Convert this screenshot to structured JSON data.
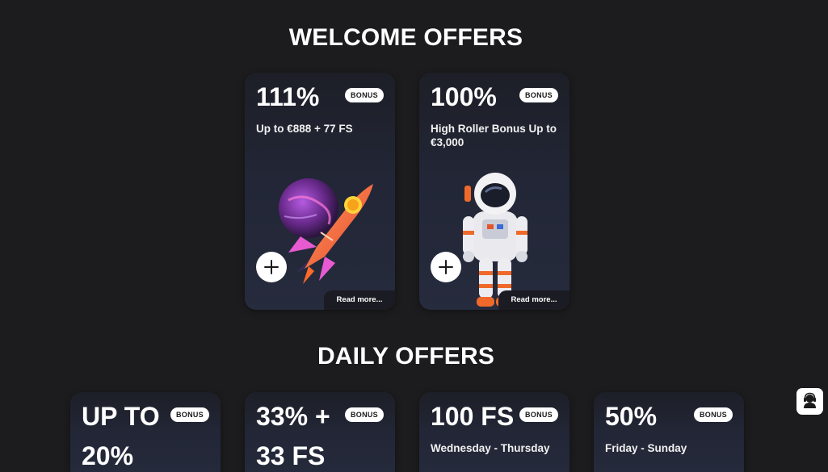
{
  "welcome": {
    "title": "WELCOME OFFERS",
    "cards": [
      {
        "percent": "111%",
        "badge": "BONUS",
        "desc": "Up to €888 + 77 FS",
        "read_more": "Read more...",
        "icon": "rocket-illustration"
      },
      {
        "percent": "100%",
        "badge": "BONUS",
        "desc": "High Roller Bonus Up to €3,000",
        "read_more": "Read more...",
        "icon": "astronaut-illustration"
      }
    ]
  },
  "daily": {
    "title": "DAILY OFFERS",
    "cards": [
      {
        "percent": "UP TO 20%",
        "badge": "BONUS",
        "desc": ""
      },
      {
        "percent": "33% + 33 FS",
        "badge": "BONUS",
        "desc": ""
      },
      {
        "percent": "100 FS",
        "badge": "BONUS",
        "desc": "Wednesday - Thursday"
      },
      {
        "percent": "50%",
        "badge": "BONUS",
        "desc": "Friday - Sunday"
      }
    ]
  },
  "support": {
    "icon": "support-agent-icon"
  },
  "colors": {
    "background": "#1c1b1d",
    "card": "#232736",
    "badge_bg": "#ffffff",
    "text": "#ffffff"
  }
}
